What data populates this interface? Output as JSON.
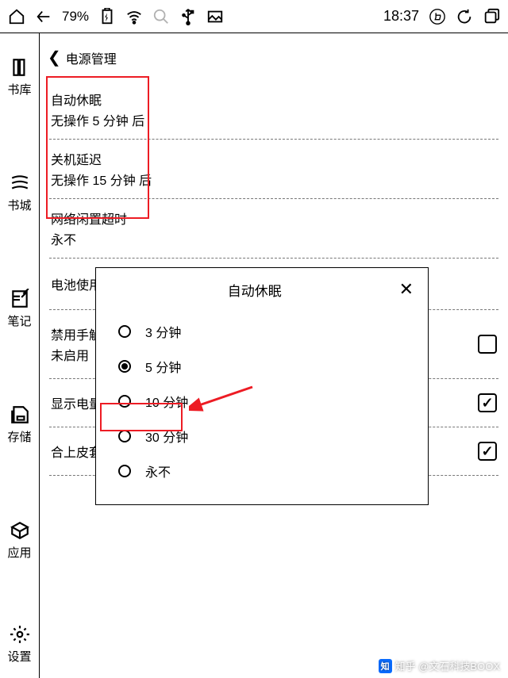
{
  "status": {
    "battery_pct": "79%",
    "time": "18:37"
  },
  "sidebar": {
    "items": [
      {
        "label": "书库"
      },
      {
        "label": "书城"
      },
      {
        "label": "笔记"
      },
      {
        "label": "存储"
      },
      {
        "label": "应用"
      },
      {
        "label": "设置"
      }
    ]
  },
  "header": {
    "title": "电源管理"
  },
  "settings": [
    {
      "title": "自动休眠",
      "sub": "无操作 5 分钟 后"
    },
    {
      "title": "关机延迟",
      "sub": "无操作 15 分钟 后"
    },
    {
      "title": "网络闲置超时",
      "sub": "永不"
    },
    {
      "title": "电池使用情况",
      "sub": ""
    },
    {
      "title": "禁用手触",
      "sub": "未启用",
      "checkbox": false
    },
    {
      "title": "显示电量",
      "sub": "",
      "checkbox": true
    },
    {
      "title": "合上皮套",
      "sub": "",
      "checkbox": true
    }
  ],
  "modal": {
    "title": "自动休眠",
    "options": [
      {
        "label": "3 分钟",
        "selected": false
      },
      {
        "label": "5 分钟",
        "selected": true
      },
      {
        "label": "10 分钟",
        "selected": false
      },
      {
        "label": "30 分钟",
        "selected": false
      },
      {
        "label": "永不",
        "selected": false
      }
    ]
  },
  "watermark": "知乎 @文石科技BOOX"
}
